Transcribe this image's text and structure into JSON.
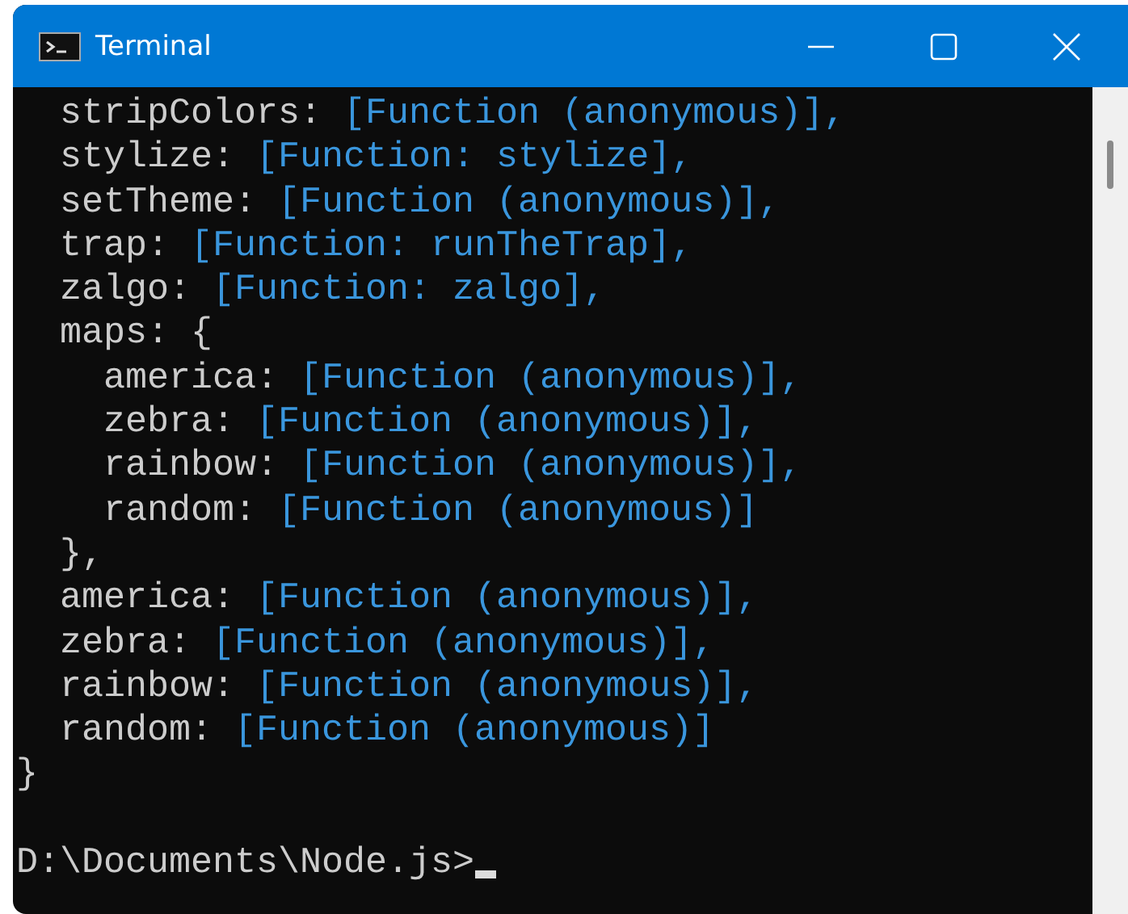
{
  "window": {
    "title": "Terminal"
  },
  "output": {
    "entries": [
      {
        "key": "stripColors:",
        "value": "[Function (anonymous)],"
      },
      {
        "key": "stylize:",
        "value": "[Function: stylize],"
      },
      {
        "key": "setTheme:",
        "value": "[Function (anonymous)],"
      },
      {
        "key": "trap:",
        "value": "[Function: runTheTrap],"
      },
      {
        "key": "zalgo:",
        "value": "[Function: zalgo],"
      },
      {
        "key": "maps: {",
        "close": "},",
        "children": [
          {
            "key": "america:",
            "value": "[Function (anonymous)],"
          },
          {
            "key": "zebra:",
            "value": "[Function (anonymous)],"
          },
          {
            "key": "rainbow:",
            "value": "[Function (anonymous)],"
          },
          {
            "key": "random:",
            "value": "[Function (anonymous)]"
          }
        ]
      },
      {
        "key": "america:",
        "value": "[Function (anonymous)],"
      },
      {
        "key": "zebra:",
        "value": "[Function (anonymous)],"
      },
      {
        "key": "rainbow:",
        "value": "[Function (anonymous)],"
      },
      {
        "key": "random:",
        "value": "[Function (anonymous)]"
      }
    ],
    "closing": "}"
  },
  "prompt": {
    "text": "D:\\Documents\\Node.js>"
  }
}
